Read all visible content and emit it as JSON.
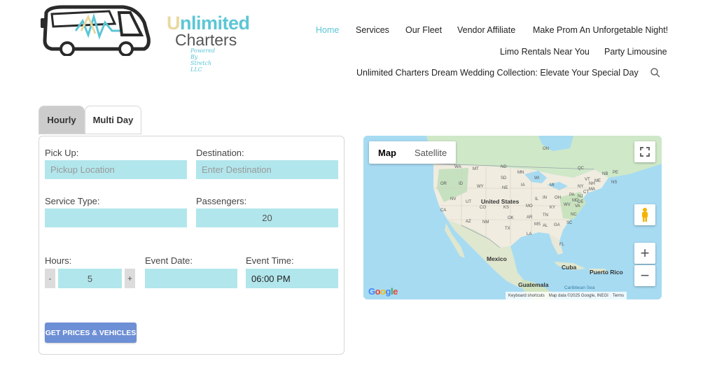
{
  "logo": {
    "line1_u": "U",
    "line1_rest": "nlimited",
    "line2": "Charters",
    "tagline": "Powered By Stretch LLC"
  },
  "nav": {
    "home": "Home",
    "services": "Services",
    "fleet": "Our Fleet",
    "vendor": "Vendor Affiliate",
    "prom": "Make Prom An Unforgetable Night!",
    "limo": "Limo Rentals Near You",
    "party": "Party Limousine",
    "wedding": "Unlimited Charters Dream Wedding Collection: Elevate Your Special Day"
  },
  "tabs": {
    "hourly": "Hourly",
    "multiday": "Multi Day"
  },
  "form": {
    "pickup_label": "Pick Up:",
    "pickup_placeholder": "Pickup Location",
    "destination_label": "Destination:",
    "destination_placeholder": "Enter Destination",
    "service_label": "Service Type:",
    "service_value": "",
    "passengers_label": "Passengers:",
    "passengers_value": "20",
    "hours_label": "Hours:",
    "hours_value": "5",
    "minus": "-",
    "plus": "+",
    "date_label": "Event Date:",
    "date_value": "",
    "time_label": "Event Time:",
    "time_value": "06:00 PM",
    "submit": "GET PRICES & VEHICLES"
  },
  "map": {
    "type_map": "Map",
    "type_satellite": "Satellite",
    "zoom_in": "+",
    "zoom_out": "−",
    "google": "Google",
    "attrib_shortcuts": "Keyboard shortcuts",
    "attrib_data": "Map data ©2025 Google, INEGI",
    "attrib_terms": "Terms",
    "labels": {
      "us": "United States",
      "mexico": "Mexico",
      "cuba": "Cuba",
      "pr": "Puerto Rico",
      "guatemala": "Guatemala",
      "caribbean": "Caribbean Sea",
      "states": [
        "WA",
        "MT",
        "ND",
        "MN",
        "OR",
        "ID",
        "SD",
        "WI",
        "WY",
        "NE",
        "IA",
        "NV",
        "UT",
        "CO",
        "KS",
        "MO",
        "CA",
        "AZ",
        "NM",
        "OK",
        "AR",
        "TX",
        "LA",
        "MS",
        "AL",
        "GA",
        "FL",
        "TN",
        "KY",
        "IN",
        "IL",
        "OH",
        "MI",
        "WV",
        "VA",
        "NC",
        "SC",
        "PA",
        "NY",
        "ON",
        "QC",
        "ME",
        "NB",
        "NS",
        "PE",
        "VT",
        "NH",
        "MA",
        "CT",
        "NJ",
        "MD",
        "DE"
      ]
    }
  },
  "colors": {
    "accent": "#5cc6d6",
    "field_bg": "#b1e6ec",
    "submit_bg": "#6d8fd5",
    "tab_active": "#cccccc"
  }
}
